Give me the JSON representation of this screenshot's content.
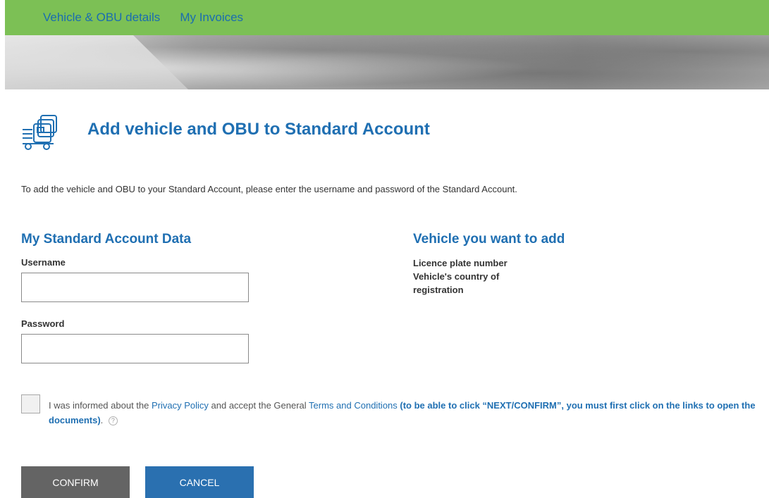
{
  "nav": {
    "items": [
      {
        "label": "Vehicle & OBU details"
      },
      {
        "label": "My Invoices"
      }
    ]
  },
  "page": {
    "title": "Add vehicle and OBU to Standard Account",
    "intro": "To add the vehicle and OBU to your Standard Account, please enter the username and password of the Standard Account."
  },
  "account_section": {
    "title": "My Standard Account Data",
    "username_label": "Username",
    "username_value": "",
    "password_label": "Password",
    "password_value": ""
  },
  "vehicle_section": {
    "title": "Vehicle you want to add",
    "licence_plate_label": "Licence plate number",
    "country_label": "Vehicle's country of registration"
  },
  "consent": {
    "checked": false,
    "text_1": "I was informed about the ",
    "privacy_link": "Privacy Policy",
    "text_2": " and accept the General ",
    "terms_link": "Terms and Conditions",
    "note": " (to be able to click “NEXT/CONFIRM”, you must first click on the links to open the documents)",
    "end": ".",
    "help_icon": "?"
  },
  "buttons": {
    "confirm_label": "CONFIRM",
    "cancel_label": "CANCEL"
  },
  "colors": {
    "nav_bg": "#7cc055",
    "accent": "#1f6fb2",
    "confirm_bg": "#646464",
    "cancel_bg": "#2a70b0"
  },
  "icons": {
    "header": "truck-fleet-icon",
    "help": "help-icon"
  }
}
